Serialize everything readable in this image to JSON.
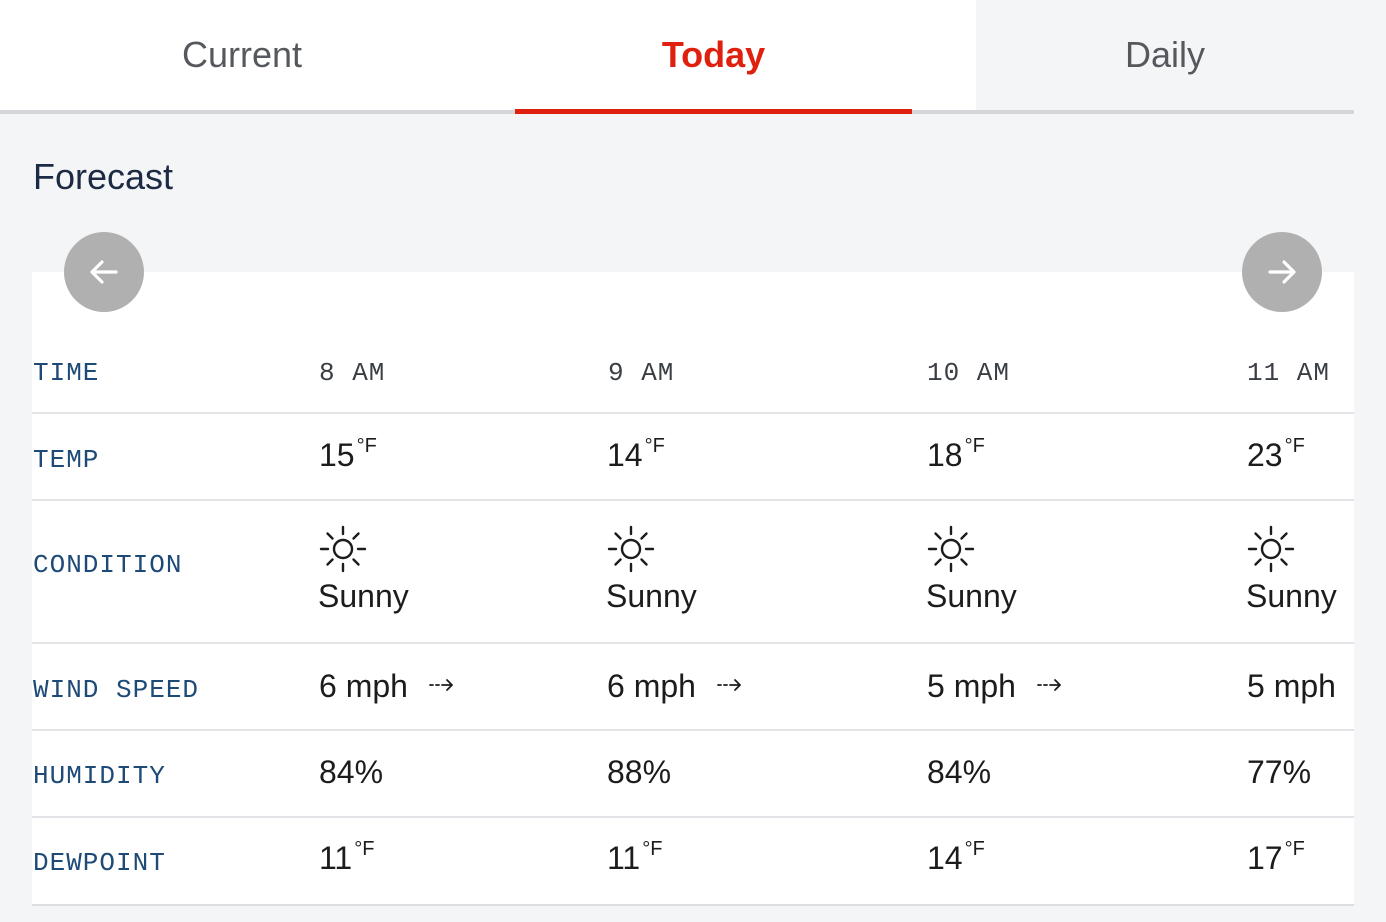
{
  "tabs": [
    {
      "label": "Current",
      "active": false
    },
    {
      "label": "Today",
      "active": true
    },
    {
      "label": "Daily",
      "active": false
    }
  ],
  "colors": {
    "accent": "#e0200f",
    "label": "#1e4a78",
    "heading": "#1d2a44",
    "nav_button": "#b0b0b0"
  },
  "heading": "Forecast",
  "nav": {
    "prev_icon": "arrow-left-icon",
    "next_icon": "arrow-right-icon"
  },
  "forecast": {
    "labels": {
      "time": "TIME",
      "temp": "TEMP",
      "condition": "CONDITION",
      "wind": "WIND SPEED",
      "humidity": "HUMIDITY",
      "dewpoint": "DEWPOINT"
    },
    "temp_unit": "°F",
    "columns": [
      {
        "time": "8 AM",
        "temp": "15",
        "condition": "Sunny",
        "condition_icon": "sun-icon",
        "wind": "6 mph",
        "wind_icon": "wind-direction-icon",
        "humidity": "84%",
        "dewpoint": "11"
      },
      {
        "time": "9 AM",
        "temp": "14",
        "condition": "Sunny",
        "condition_icon": "sun-icon",
        "wind": "6 mph",
        "wind_icon": "wind-direction-icon",
        "humidity": "88%",
        "dewpoint": "11"
      },
      {
        "time": "10 AM",
        "temp": "18",
        "condition": "Sunny",
        "condition_icon": "sun-icon",
        "wind": "5 mph",
        "wind_icon": "wind-direction-icon",
        "humidity": "84%",
        "dewpoint": "14"
      },
      {
        "time": "11 AM",
        "temp": "23",
        "condition": "Sunny",
        "condition_icon": "sun-icon",
        "wind": "5 mph",
        "humidity": "77%",
        "dewpoint": "17"
      }
    ]
  }
}
